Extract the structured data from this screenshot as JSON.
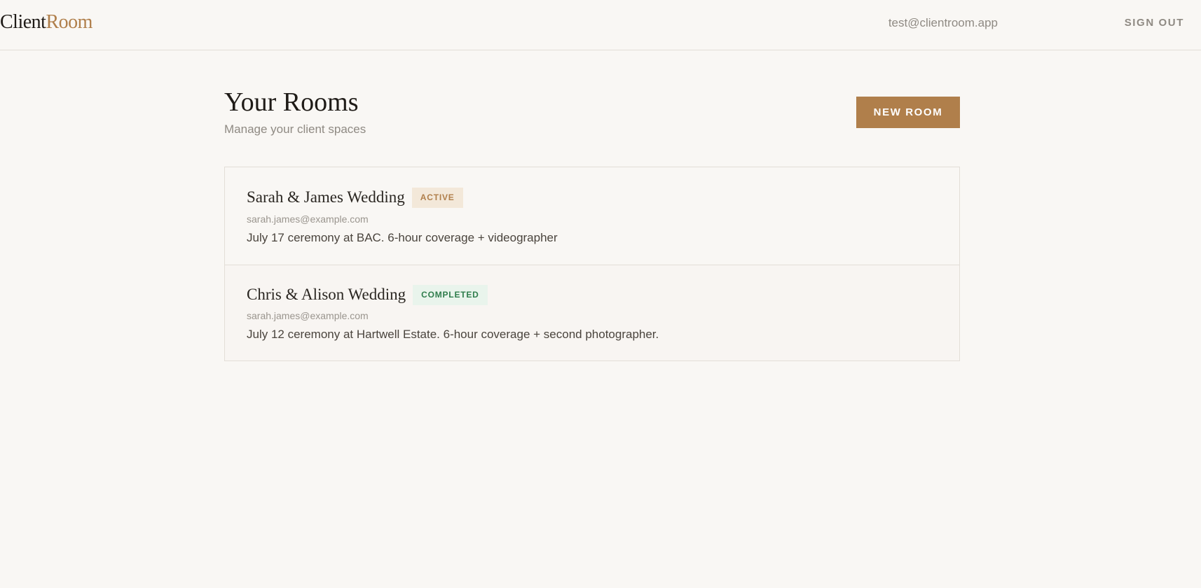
{
  "header": {
    "brand_part_a": "Client",
    "brand_part_b": "Room",
    "user_email": "test@clientroom.app",
    "sign_out_label": "SIGN OUT"
  },
  "page": {
    "title": "Your Rooms",
    "subtitle": "Manage your client spaces",
    "new_room_label": "NEW ROOM"
  },
  "rooms": [
    {
      "name": "Sarah & James Wedding",
      "status": "ACTIVE",
      "email": "sarah.james@example.com",
      "description": "July 17 ceremony at BAC. 6-hour coverage + videographer"
    },
    {
      "name": "Chris & Alison Wedding",
      "status": "COMPLETED",
      "email": "sarah.james@example.com",
      "description": "July 12 ceremony at Hartwell Estate. 6-hour coverage + second photographer."
    }
  ],
  "colors": {
    "background": "#f9f7f4",
    "accent": "#b07f4b",
    "active_badge_bg": "#f3e8d9",
    "completed_badge_bg": "#e9f4ec",
    "completed_badge_text": "#2f7d4c",
    "muted_text": "#8f8a83",
    "border": "#e3ded7"
  }
}
